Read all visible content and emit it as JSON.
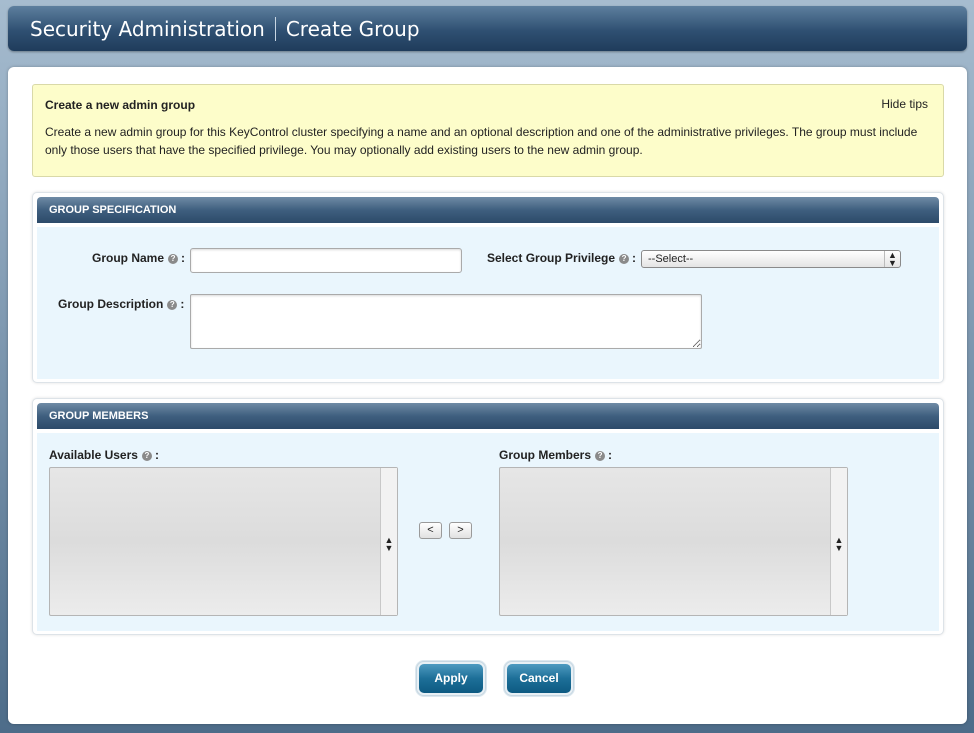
{
  "header": {
    "section": "Security Administration",
    "page": "Create Group"
  },
  "tips": {
    "title": "Create a new admin group",
    "hide_label": "Hide tips",
    "text": "Create a new admin group for this KeyControl cluster specifying a name and an optional description and one of the administrative privileges. The group must include only those users that have the specified privilege. You may optionally add existing users to the new admin group."
  },
  "spec": {
    "heading": "GROUP SPECIFICATION",
    "name_label": "Group Name",
    "name_value": "",
    "privilege_label": "Select Group Privilege",
    "privilege_selected": "--Select--",
    "description_label": "Group Description",
    "description_value": ""
  },
  "members": {
    "heading": "GROUP MEMBERS",
    "available_label": "Available Users",
    "members_label": "Group Members",
    "move_left": "<",
    "move_right": ">"
  },
  "actions": {
    "apply": "Apply",
    "cancel": "Cancel"
  }
}
